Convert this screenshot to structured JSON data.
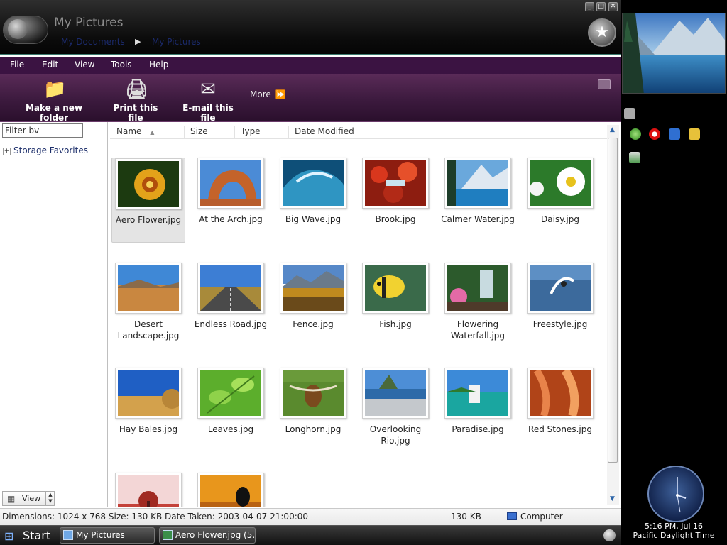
{
  "window": {
    "title": "My Pictures",
    "breadcrumb": [
      "My Documents",
      "My Pictures"
    ],
    "breadcrumb_separator": "▶",
    "controls": {
      "minimize": "_",
      "maximize": "□",
      "close": "✕"
    }
  },
  "menu": [
    "File",
    "Edit",
    "View",
    "Tools",
    "Help"
  ],
  "toolbar": {
    "new_folder": "Make a new folder",
    "print": "Print this file",
    "email": "E-mail this file",
    "more": "More",
    "more_arrow": "⏩"
  },
  "left_pane": {
    "filter_value": "Filter bv",
    "storage_favorites": "Storage Favorites",
    "view_label": "View"
  },
  "columns": [
    "Name",
    "Size",
    "Type",
    "Date Modified"
  ],
  "sort_indicator": "▲",
  "files": [
    {
      "name": "Aero Flower.jpg",
      "selected": true
    },
    {
      "name": "At the Arch.jpg"
    },
    {
      "name": "Big Wave.jpg"
    },
    {
      "name": "Brook.jpg"
    },
    {
      "name": "Calmer Water.jpg"
    },
    {
      "name": "Daisy.jpg"
    },
    {
      "name": "Desert Landscape.jpg"
    },
    {
      "name": "Endless Road.jpg"
    },
    {
      "name": "Fence.jpg"
    },
    {
      "name": "Fish.jpg"
    },
    {
      "name": "Flowering Waterfall.jpg"
    },
    {
      "name": "Freestyle.jpg"
    },
    {
      "name": "Hay Bales.jpg"
    },
    {
      "name": "Leaves.jpg"
    },
    {
      "name": "Longhorn.jpg"
    },
    {
      "name": "Overlooking Rio.jpg"
    },
    {
      "name": "Paradise.jpg"
    },
    {
      "name": "Red Stones.jpg"
    },
    {
      "name": ""
    },
    {
      "name": ""
    }
  ],
  "status": {
    "details": "Dimensions: 1024 x 768 Size: 130 KB Date Taken: 2003-04-07 21:00:00",
    "size": "130 KB",
    "zone": "Computer"
  },
  "taskbar": {
    "start": "Start",
    "tasks": [
      "My Pictures",
      "Aero Flower.jpg (5..."
    ]
  },
  "sidebar": {
    "clock_time": "5:16 PM, Jul 16",
    "clock_zone": "Pacific Daylight Time"
  },
  "colors": {
    "menubar": "#3b1342",
    "toolbar": "#4a2148",
    "accent_line": "#3b7a6e"
  }
}
